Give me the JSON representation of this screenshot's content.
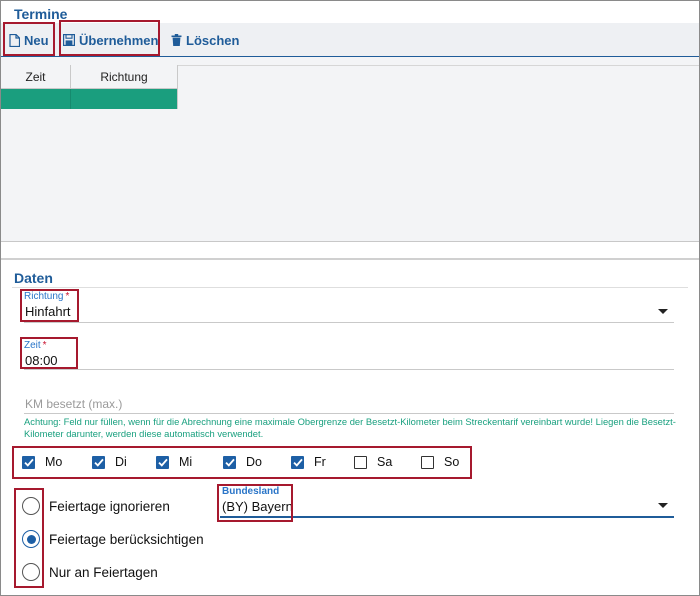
{
  "termine": {
    "title": "Termine",
    "toolbar": {
      "new_label": "Neu",
      "apply_label": "Übernehmen",
      "delete_label": "Löschen"
    },
    "grid": {
      "columns": [
        "Zeit",
        "Richtung"
      ],
      "rows": [
        [
          "",
          ""
        ]
      ]
    }
  },
  "daten": {
    "title": "Daten",
    "richtung": {
      "label": "Richtung",
      "required": "*",
      "value": "Hinfahrt"
    },
    "zeit": {
      "label": "Zeit",
      "required": "*",
      "value": "08:00"
    },
    "km": {
      "placeholder": "KM besetzt (max.)",
      "hint": "Achtung: Feld nur füllen, wenn für die Abrechnung eine maximale Obergrenze der Besetzt-Kilometer beim Streckentarif vereinbart wurde! Liegen die Besetzt-Kilometer darunter, werden diese automatisch verwendet."
    },
    "weekdays": [
      {
        "label": "Mo",
        "checked": true
      },
      {
        "label": "Di",
        "checked": true
      },
      {
        "label": "Mi",
        "checked": true
      },
      {
        "label": "Do",
        "checked": true
      },
      {
        "label": "Fr",
        "checked": true
      },
      {
        "label": "Sa",
        "checked": false
      },
      {
        "label": "So",
        "checked": false
      }
    ],
    "holidays": {
      "options": [
        {
          "label": "Feiertage ignorieren",
          "selected": false
        },
        {
          "label": "Feiertage berücksichtigen",
          "selected": true
        },
        {
          "label": "Nur an Feiertagen",
          "selected": false
        }
      ]
    },
    "bundesland": {
      "label": "Bundesland",
      "value": "(BY) Bayern"
    }
  },
  "colors": {
    "accent": "#1f5c99",
    "label_blue": "#2a75c8",
    "selected_row": "#1a9e7e",
    "hint_green": "#19a07f",
    "highlight_box": "#a6192e",
    "required": "#c8102e"
  }
}
